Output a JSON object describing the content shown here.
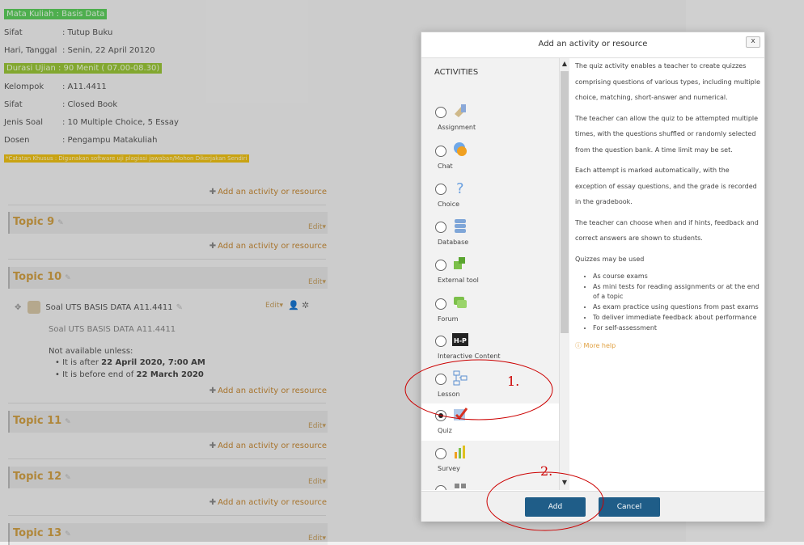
{
  "info": {
    "mata_kuliah": "Mata Kuliah     : Basis Data",
    "sifat1_k": "Sifat",
    "sifat1_v": ": Tutup Buku",
    "hari_k": "Hari, Tanggal",
    "hari_v": ": Senin, 22 April 20120",
    "durasi": "Durasi Ujian     : 90 Menit ( 07.00-08.30)",
    "kelompok_k": "Kelompok",
    "kelompok_v": ": A11.4411",
    "sifat2_k": "Sifat",
    "sifat2_v": ": Closed Book",
    "jenis_k": "Jenis Soal",
    "jenis_v": ": 10 Multiple Choice, 5 Essay",
    "dosen_k": "Dosen",
    "dosen_v": ": Pengampu Matakuliah",
    "catatan": "*Catatan Khusus : Digunakan software uji plagiasi jawaban/Mohon Dikerjakan Sendiri"
  },
  "add_activity_label": "Add an activity or resource",
  "topics": [
    {
      "title": "Topic 9",
      "edit": "Edit"
    },
    {
      "title": "Topic 10",
      "edit": "Edit"
    },
    {
      "title": "Topic 11",
      "edit": "Edit"
    },
    {
      "title": "Topic 12",
      "edit": "Edit"
    },
    {
      "title": "Topic 13",
      "edit": "Edit"
    }
  ],
  "activity": {
    "title": "Soal UTS BASIS DATA A11.4411",
    "edit": "Edit",
    "description": "Soal UTS BASIS DATA A11.4411",
    "restriction_head": "Not available unless:",
    "r1_pre": "It is after ",
    "r1_bold": "22 April 2020, 7:00 AM",
    "r2_pre": "It is before end of ",
    "r2_bold": "22 March 2020"
  },
  "dialog": {
    "title": "Add an activity or resource",
    "close": "x",
    "activities_header": "ACTIVITIES",
    "options": [
      {
        "label": "Assignment",
        "icon": "assignment-icon",
        "selected": false
      },
      {
        "label": "Chat",
        "icon": "chat-icon",
        "selected": false
      },
      {
        "label": "Choice",
        "icon": "choice-icon",
        "selected": false
      },
      {
        "label": "Database",
        "icon": "database-icon",
        "selected": false
      },
      {
        "label": "External tool",
        "icon": "external-tool-icon",
        "selected": false
      },
      {
        "label": "Forum",
        "icon": "forum-icon",
        "selected": false
      },
      {
        "label": "Interactive Content",
        "icon": "h5p-icon",
        "selected": false
      },
      {
        "label": "Lesson",
        "icon": "lesson-icon",
        "selected": false
      },
      {
        "label": "Quiz",
        "icon": "quiz-icon",
        "selected": true
      },
      {
        "label": "Survey",
        "icon": "survey-icon",
        "selected": false
      },
      {
        "label": "Wiki",
        "icon": "wiki-icon",
        "selected": false
      }
    ],
    "h5p_text": "H-P",
    "desc_p1": "The quiz activity enables a teacher to create quizzes comprising questions of various types, including multiple choice, matching, short-answer and numerical.",
    "desc_p2": "The teacher can allow the quiz to be attempted multiple times, with the questions shuffled or randomly selected from the question bank. A time limit may be set.",
    "desc_p3": "Each attempt is marked automatically, with the exception of essay questions, and the grade is recorded in the gradebook.",
    "desc_p4": "The teacher can choose when and if hints, feedback and correct answers are shown to students.",
    "desc_p5": "Quizzes may be used",
    "uses": [
      "As course exams",
      "As mini tests for reading assignments or at the end of a topic",
      "As exam practice using questions from past exams",
      "To deliver immediate feedback about performance",
      "For self-assessment"
    ],
    "more_help": "More help",
    "add_button": "Add",
    "cancel_button": "Cancel"
  },
  "annotations": {
    "one": "1.",
    "two": "2."
  },
  "colors": {
    "accent": "#1f5d88",
    "link": "#c88b36",
    "annotation": "#cc0000"
  }
}
